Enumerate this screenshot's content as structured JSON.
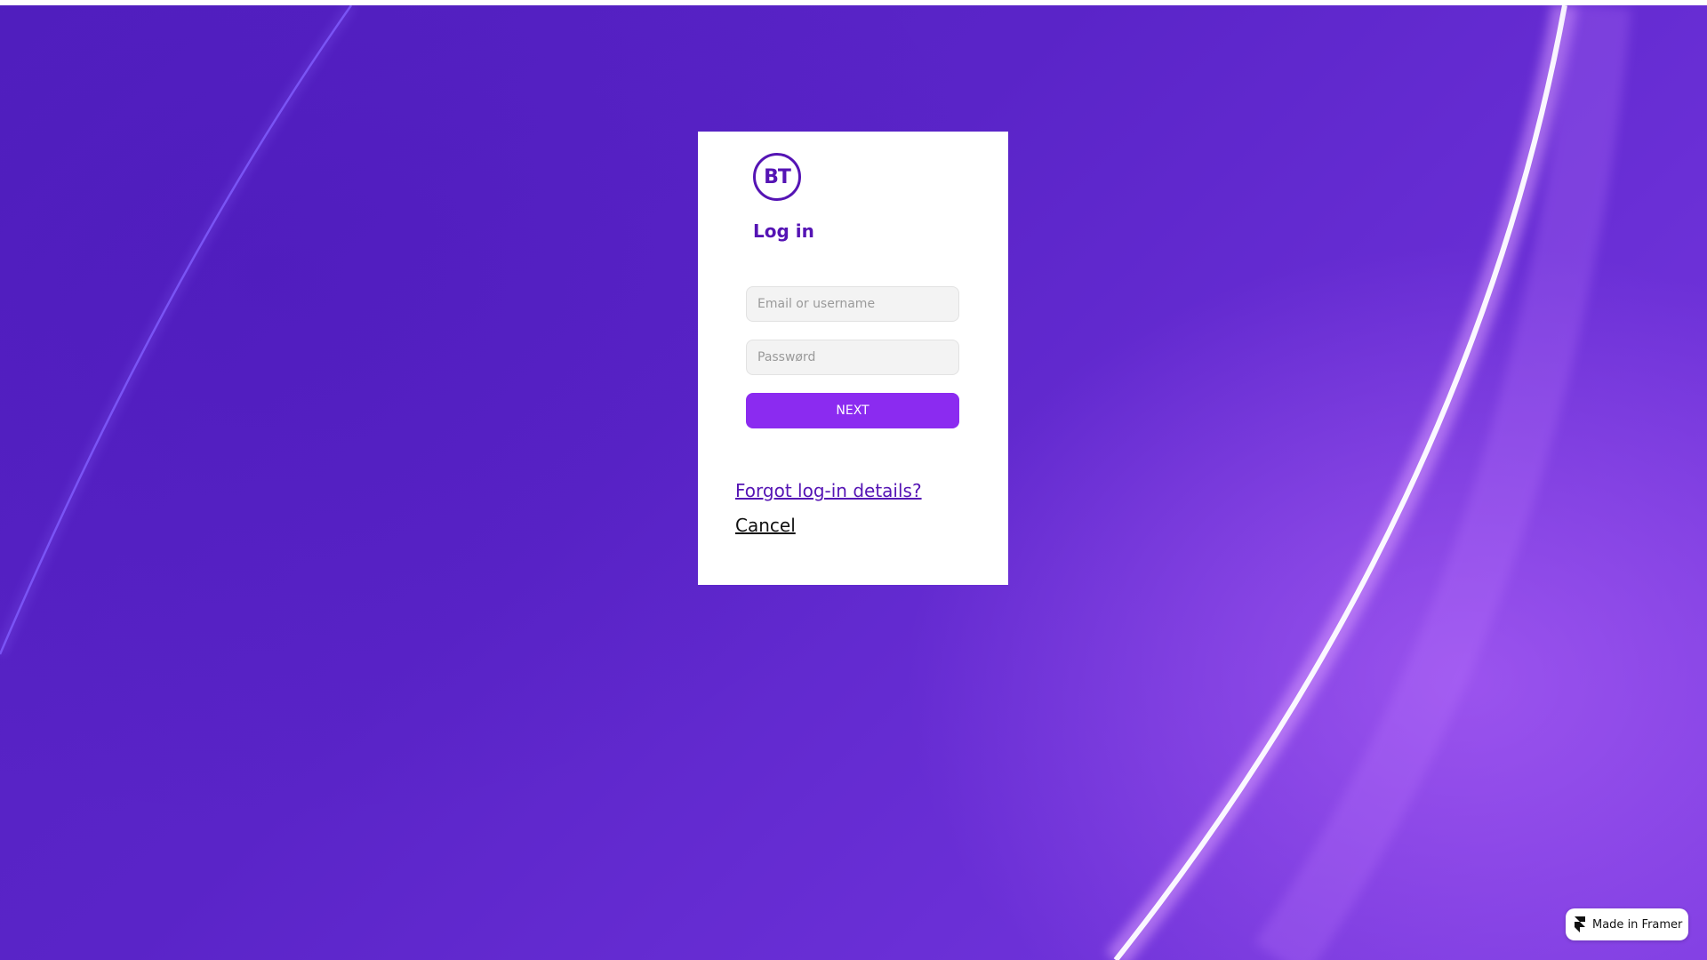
{
  "page": {
    "background_start": "#5220c0",
    "background_end": "#7b3ae0"
  },
  "login_card": {
    "logo_text": "BT",
    "title": "Log in",
    "email_placeholder": "Email or username",
    "password_placeholder": "Passwørd",
    "next_label": "NEXT",
    "forgot_link": "Forgot log-in details?",
    "cancel_link": "Cancel",
    "brand_color": "#5514b4",
    "button_color": "#8b2bf0"
  },
  "badge": {
    "label": "Made in Framer",
    "icon": "framer-icon"
  }
}
